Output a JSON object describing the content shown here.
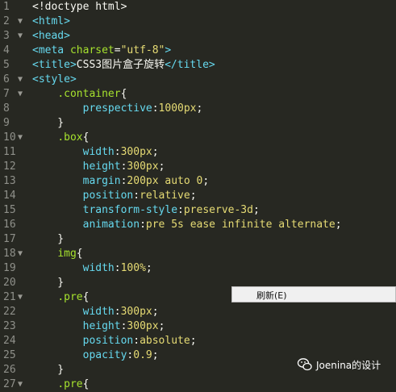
{
  "editor": {
    "lines": [
      {
        "n": "1",
        "fold": "",
        "tokens": [
          [
            "w",
            "<!doctype html>"
          ]
        ]
      },
      {
        "n": "2",
        "fold": "▼",
        "tokens": [
          [
            "t",
            "<html>"
          ]
        ]
      },
      {
        "n": "3",
        "fold": "▼",
        "tokens": [
          [
            "t",
            "<head>"
          ]
        ]
      },
      {
        "n": "4",
        "fold": "",
        "tokens": [
          [
            "t",
            "<meta "
          ],
          [
            "a",
            "charset"
          ],
          [
            "w",
            "="
          ],
          [
            "s",
            "\"utf-8\""
          ],
          [
            "t",
            ">"
          ]
        ]
      },
      {
        "n": "5",
        "fold": "",
        "tokens": [
          [
            "t",
            "<title>"
          ],
          [
            "w",
            "CSS3图片盒子旋转"
          ],
          [
            "t",
            "</title>"
          ]
        ]
      },
      {
        "n": "6",
        "fold": "▼",
        "tokens": [
          [
            "t",
            "<style>"
          ]
        ]
      },
      {
        "n": "7",
        "fold": "▼",
        "tokens": [
          [
            "w",
            "    "
          ],
          [
            "sel",
            ".container"
          ],
          [
            "w",
            "{"
          ]
        ]
      },
      {
        "n": "8",
        "fold": "",
        "tokens": [
          [
            "w",
            "        "
          ],
          [
            "p",
            "prespective"
          ],
          [
            "w",
            ":"
          ],
          [
            "v",
            "1000px"
          ],
          [
            "w",
            ";"
          ]
        ]
      },
      {
        "n": "9",
        "fold": "",
        "tokens": [
          [
            "w",
            "    }"
          ]
        ]
      },
      {
        "n": "10",
        "fold": "▼",
        "tokens": [
          [
            "w",
            "    "
          ],
          [
            "sel",
            ".box"
          ],
          [
            "w",
            "{"
          ]
        ]
      },
      {
        "n": "11",
        "fold": "",
        "tokens": [
          [
            "w",
            "        "
          ],
          [
            "p",
            "width"
          ],
          [
            "w",
            ":"
          ],
          [
            "v",
            "300px"
          ],
          [
            "w",
            ";"
          ]
        ]
      },
      {
        "n": "12",
        "fold": "",
        "tokens": [
          [
            "w",
            "        "
          ],
          [
            "p",
            "height"
          ],
          [
            "w",
            ":"
          ],
          [
            "v",
            "300px"
          ],
          [
            "w",
            ";"
          ]
        ]
      },
      {
        "n": "13",
        "fold": "",
        "tokens": [
          [
            "w",
            "        "
          ],
          [
            "p",
            "margin"
          ],
          [
            "w",
            ":"
          ],
          [
            "v",
            "200px auto 0"
          ],
          [
            "w",
            ";"
          ]
        ]
      },
      {
        "n": "14",
        "fold": "",
        "tokens": [
          [
            "w",
            "        "
          ],
          [
            "p",
            "position"
          ],
          [
            "w",
            ":"
          ],
          [
            "v",
            "relative"
          ],
          [
            "w",
            ";"
          ]
        ]
      },
      {
        "n": "15",
        "fold": "",
        "tokens": [
          [
            "w",
            "        "
          ],
          [
            "p",
            "transform-style"
          ],
          [
            "w",
            ":"
          ],
          [
            "v",
            "preserve-3d"
          ],
          [
            "w",
            ";"
          ]
        ]
      },
      {
        "n": "16",
        "fold": "",
        "tokens": [
          [
            "w",
            "        "
          ],
          [
            "p",
            "animation"
          ],
          [
            "w",
            ":"
          ],
          [
            "v",
            "pre 5s ease infinite alternate"
          ],
          [
            "w",
            ";"
          ]
        ]
      },
      {
        "n": "17",
        "fold": "",
        "tokens": [
          [
            "w",
            "    }"
          ]
        ]
      },
      {
        "n": "18",
        "fold": "▼",
        "tokens": [
          [
            "w",
            "    "
          ],
          [
            "sel",
            "img"
          ],
          [
            "w",
            "{"
          ]
        ]
      },
      {
        "n": "19",
        "fold": "",
        "tokens": [
          [
            "w",
            "        "
          ],
          [
            "p",
            "width"
          ],
          [
            "w",
            ":"
          ],
          [
            "v",
            "100%"
          ],
          [
            "w",
            ";"
          ]
        ]
      },
      {
        "n": "20",
        "fold": "",
        "tokens": [
          [
            "w",
            "    }"
          ]
        ]
      },
      {
        "n": "21",
        "fold": "▼",
        "tokens": [
          [
            "w",
            "    "
          ],
          [
            "sel",
            ".pre"
          ],
          [
            "w",
            "{"
          ]
        ]
      },
      {
        "n": "22",
        "fold": "",
        "tokens": [
          [
            "w",
            "        "
          ],
          [
            "p",
            "width"
          ],
          [
            "w",
            ":"
          ],
          [
            "v",
            "300px"
          ],
          [
            "w",
            ";"
          ]
        ]
      },
      {
        "n": "23",
        "fold": "",
        "tokens": [
          [
            "w",
            "        "
          ],
          [
            "p",
            "height"
          ],
          [
            "w",
            ":"
          ],
          [
            "v",
            "300px"
          ],
          [
            "w",
            ";"
          ]
        ]
      },
      {
        "n": "24",
        "fold": "",
        "tokens": [
          [
            "w",
            "        "
          ],
          [
            "p",
            "position"
          ],
          [
            "w",
            ":"
          ],
          [
            "v",
            "absolute"
          ],
          [
            "w",
            ";"
          ]
        ]
      },
      {
        "n": "25",
        "fold": "",
        "tokens": [
          [
            "w",
            "        "
          ],
          [
            "p",
            "opacity"
          ],
          [
            "w",
            ":"
          ],
          [
            "v",
            "0.9"
          ],
          [
            "w",
            ";"
          ]
        ]
      },
      {
        "n": "26",
        "fold": "",
        "tokens": [
          [
            "w",
            "    }"
          ]
        ]
      },
      {
        "n": "27",
        "fold": "▼",
        "tokens": [
          [
            "w",
            "    "
          ],
          [
            "sel",
            ".pre"
          ],
          [
            "w",
            "{"
          ]
        ]
      }
    ]
  },
  "context_menu": {
    "items": [
      {
        "label": "刷新(E)"
      }
    ]
  },
  "watermark": {
    "text": "Joenina的设计",
    "icon": "wechat-icon"
  },
  "colors": {
    "background": "#272822",
    "tag": "#66d9ef",
    "selector": "#a6e22e",
    "string": "#e6db74",
    "plain": "#f8f8f2",
    "line_number": "#8f908a"
  }
}
